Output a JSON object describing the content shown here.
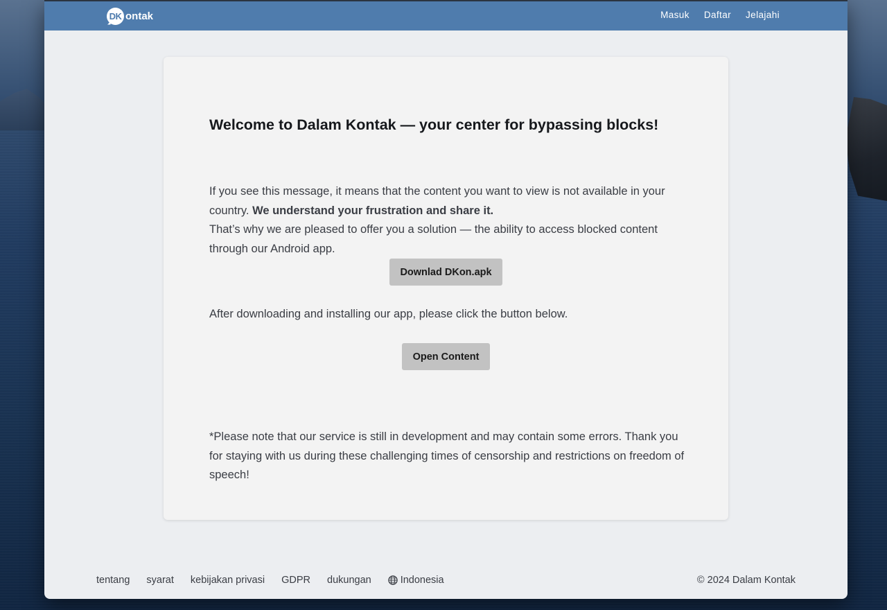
{
  "header": {
    "logo_badge": "DK",
    "logo_text": "ontak",
    "nav": [
      "Masuk",
      "Daftar",
      "Jelajahi"
    ]
  },
  "main": {
    "title": "Welcome to Dalam Kontak — your center for bypassing blocks!",
    "p1_text": "If you see this message, it means that the content you want to view is not available in your country. ",
    "p1_bold": "We understand your frustration and share it.",
    "p1_line2": "That’s why we are pleased to offer you a solution — the ability to access blocked content through our Android app.",
    "download_button": "Downlad DKon.apk",
    "p2_text": "After downloading and installing our app, please click the button below.",
    "open_button": "Open Content",
    "note": "*Please note that our service is still in development and may contain some errors. Thank you for staying with us during these challenging times of censorship and restrictions on freedom of speech!"
  },
  "footer": {
    "links": [
      "tentang",
      "syarat",
      "kebijakan privasi",
      "GDPR",
      "dukungan"
    ],
    "language": "Indonesia",
    "copyright": "© 2024 Dalam Kontak"
  },
  "colors": {
    "header_bg": "#4f7cad",
    "page_bg": "#eceef1",
    "card_bg": "#f3f3f3",
    "button_bg": "#c2c2c2"
  }
}
